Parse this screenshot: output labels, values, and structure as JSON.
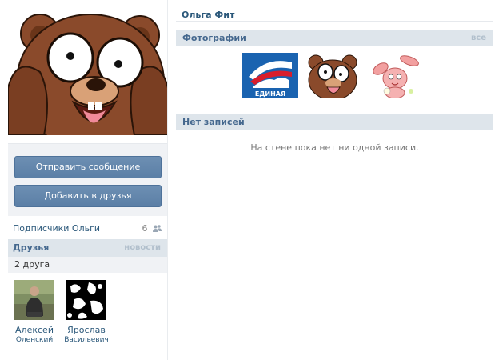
{
  "profile": {
    "name": "Ольга Фит"
  },
  "actions": {
    "send_message": "Отправить сообщение",
    "add_friend": "Добавить в друзья"
  },
  "subscribers": {
    "label": "Подписчики Ольги",
    "count": "6"
  },
  "friends": {
    "title": "Друзья",
    "news_link": "новости",
    "count_text": "2 друга",
    "items": [
      {
        "first_name": "Алексей",
        "last_name": "Оленский"
      },
      {
        "first_name": "Ярослав",
        "last_name": "Васильевич"
      }
    ]
  },
  "photos": {
    "title": "Фотографии",
    "all_link": "все",
    "items": [
      {
        "logo_text": "ЕДИНАЯ"
      },
      {
        "subject": "bear-cartoon"
      },
      {
        "subject": "bunny-cartoon"
      }
    ]
  },
  "wall": {
    "title": "Нет записей",
    "empty_text": "На стене пока нет ни одной записи."
  },
  "colors": {
    "link": "#2b587a",
    "header_bg": "#dee5eb",
    "button": "#5b7fa6",
    "panel_bg": "#f0f2f5"
  }
}
